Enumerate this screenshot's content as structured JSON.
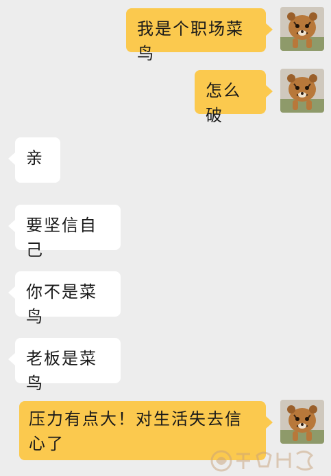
{
  "messages": [
    {
      "sender": "me",
      "text": "我是个职场菜鸟"
    },
    {
      "sender": "me",
      "text": "怎么破"
    },
    {
      "sender": "them",
      "text": "亲"
    },
    {
      "sender": "them",
      "text": "要坚信自己"
    },
    {
      "sender": "them",
      "text": "你不是菜鸟"
    },
    {
      "sender": "them",
      "text": "老板是菜鸟"
    },
    {
      "sender": "me",
      "text": "压力有点大！对生活失去信心了"
    }
  ],
  "colors": {
    "background": "#ededed",
    "me_bubble": "#fbc94e",
    "them_bubble": "#ffffff"
  },
  "avatar": {
    "icon": "tiger-cub-avatar-icon"
  },
  "watermark": {
    "icon": "site-watermark-logo"
  }
}
